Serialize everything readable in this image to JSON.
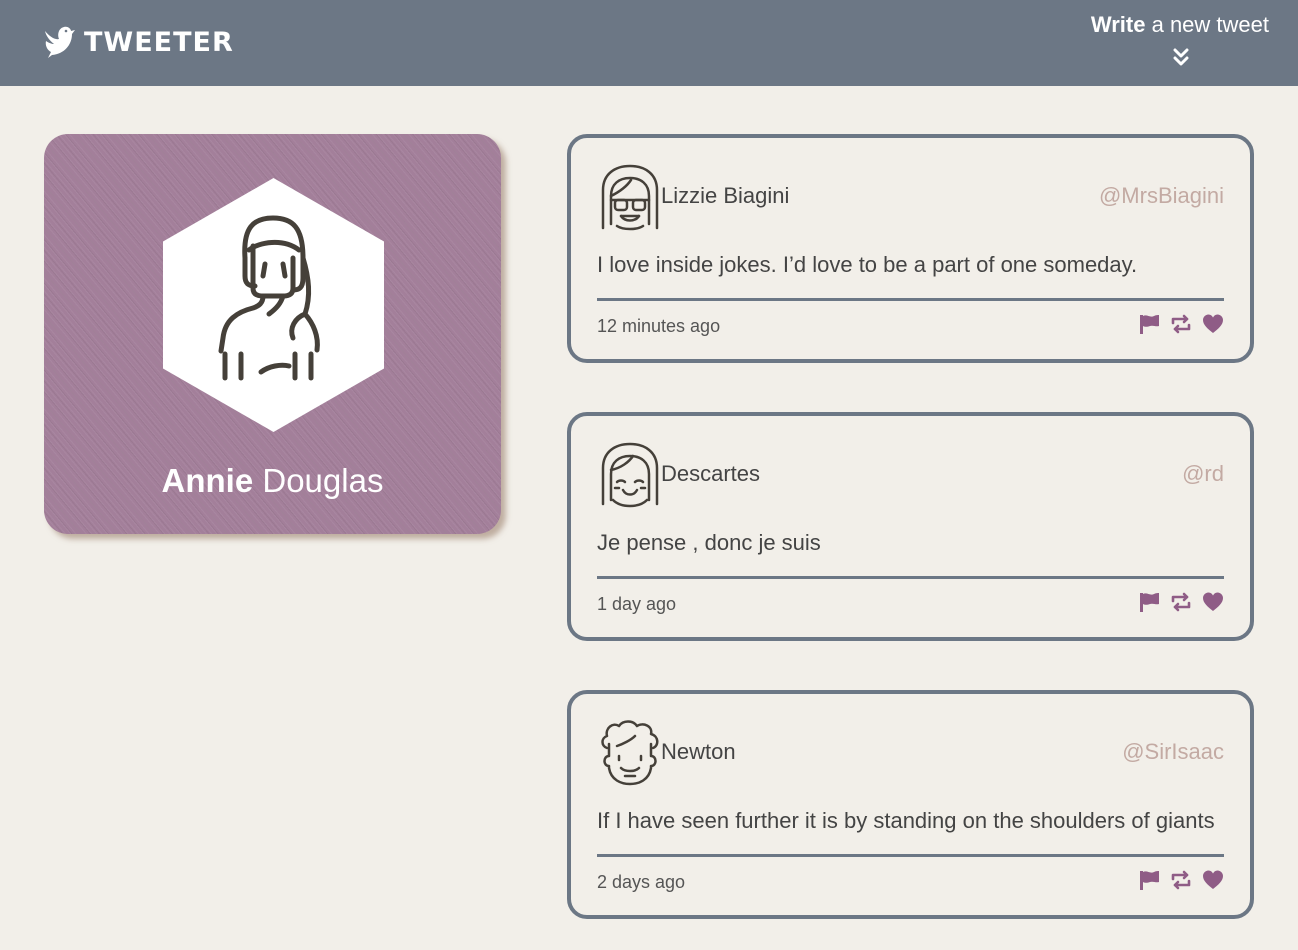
{
  "colors": {
    "navbar": "#6c7785",
    "page_background": "#f2efe9",
    "profile_card": "#a37f9a",
    "accent": "#8f5c86",
    "handle": "#c3aaa3"
  },
  "header": {
    "brand": "TWEETER",
    "brand_icon": "bird-icon",
    "compose_strong": "Write",
    "compose_rest": " a new tweet",
    "compose_icon": "double-chevron-down-icon"
  },
  "profile": {
    "avatar_icon": "woman-avatar-icon",
    "first_name": "Annie",
    "last_name": "Douglas"
  },
  "tweets": [
    {
      "avatar_icon": "sunglasses-avatar-icon",
      "name": "Lizzie Biagini",
      "handle": "@MrsBiagini",
      "content": "I love inside jokes. I’d love to be a part of one someday.",
      "time": "12 minutes ago"
    },
    {
      "avatar_icon": "smiling-avatar-icon",
      "name": "Descartes",
      "handle": "@rd",
      "content": "Je pense , donc je suis",
      "time": "1 day ago"
    },
    {
      "avatar_icon": "curly-hair-avatar-icon",
      "name": "Newton",
      "handle": "@SirIsaac",
      "content": "If I have seen further it is by standing on the shoulders of giants",
      "time": "2 days ago"
    }
  ],
  "tweet_actions": [
    "flag-icon",
    "retweet-icon",
    "heart-icon"
  ]
}
